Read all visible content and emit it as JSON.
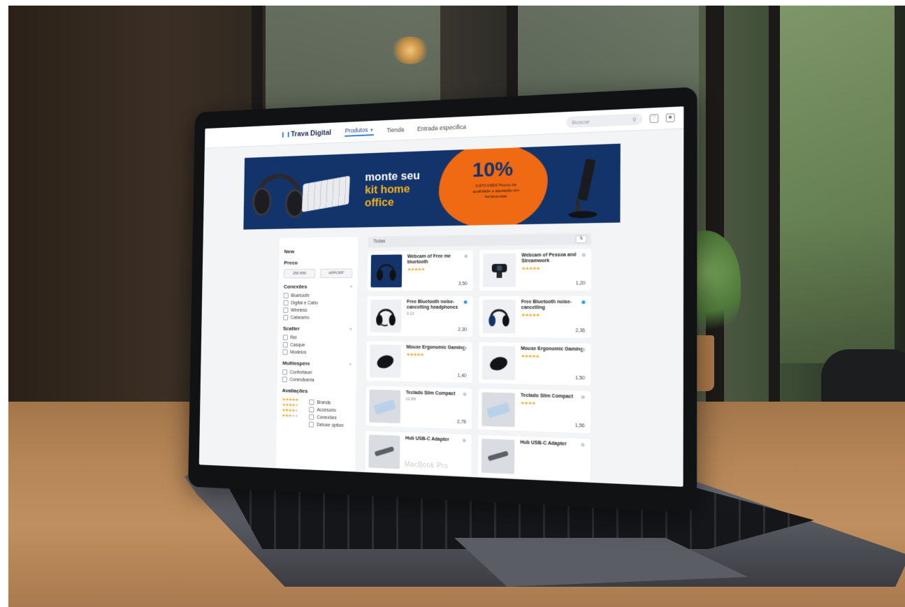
{
  "site": {
    "logo": "Trava Digital",
    "nav": [
      {
        "label": "Produtos",
        "active": true
      },
      {
        "label": "Tienda",
        "active": false
      },
      {
        "label": "Entrada especifica",
        "active": false
      }
    ],
    "search_placeholder": "Buscar"
  },
  "banner": {
    "line1": "monte seu",
    "line2": "kit home",
    "line3": "office",
    "discount": "10%",
    "discount_sub": "0,870 ASES Promo de qualidade e aquisição em ferramentas",
    "colors": {
      "background": "#13346b",
      "accent": "#ef6a13",
      "highlight": "#f5b21a"
    }
  },
  "sidebar": {
    "title": "New",
    "price": {
      "heading": "Preco",
      "min": "250 800",
      "max": "APPORT"
    },
    "groups": [
      {
        "heading": "Conexões",
        "options": [
          "Bluetooth",
          "Digital e Cabo",
          "Wireless",
          "Cabeamo"
        ]
      },
      {
        "heading": "Scatter",
        "options": [
          "Rei",
          "Casque",
          "Modelos"
        ]
      },
      {
        "heading": "Multiespére",
        "options": [
          "Confortável",
          "Conexãoeria"
        ]
      }
    ],
    "rating": {
      "heading": "Avaliações",
      "levels": [
        5,
        4,
        4,
        3,
        2
      ],
      "side_options": [
        "Brands",
        "Accesorio",
        "Conexões",
        "Deluxe option"
      ]
    }
  },
  "grid": {
    "header": "Todas",
    "products": [
      {
        "title": "Webcam of Free me bluetooth",
        "stars": 5,
        "sub": "",
        "price": "3,50",
        "thumb": "headphones",
        "tone": "navy",
        "fav": "gray"
      },
      {
        "title": "Webcam of Pessoa and Streamwork",
        "stars": 5,
        "sub": "",
        "price": "1,20",
        "thumb": "webcam",
        "tone": "light",
        "fav": "gray"
      },
      {
        "title": "Free Bluetooth noise-cancelling headphones",
        "stars": 0,
        "sub": "0.12",
        "price": "2,30",
        "thumb": "headphones-mic",
        "tone": "light",
        "fav": "blue"
      },
      {
        "title": "Free Bluetooth noise-cancelling",
        "stars": 5,
        "sub": "",
        "price": "2,36",
        "thumb": "headphones-blue",
        "tone": "light",
        "fav": "blue"
      },
      {
        "title": "Mouse Ergonomic Gaming",
        "stars": 5,
        "sub": "",
        "price": "1,40",
        "thumb": "mouse",
        "tone": "light",
        "fav": "gray"
      },
      {
        "title": "Mouse Ergonomic Gaming",
        "stars": 5,
        "sub": "",
        "price": "1,50",
        "thumb": "mouse",
        "tone": "light",
        "fav": "gray"
      },
      {
        "title": "Teclado Slim Compact",
        "stars": 0,
        "sub": "12.88",
        "price": "2,78",
        "thumb": "keyboard",
        "tone": "gray",
        "fav": "gray"
      },
      {
        "title": "Teclado Slim Compact",
        "stars": 4,
        "sub": "",
        "price": "1,56",
        "thumb": "keyboard",
        "tone": "gray",
        "fav": "gray"
      },
      {
        "title": "Hub USB-C Adapter",
        "stars": 0,
        "sub": "",
        "price": "",
        "thumb": "hub",
        "tone": "gray",
        "fav": "gray"
      },
      {
        "title": "Hub USB-C Adapter",
        "stars": 0,
        "sub": "",
        "price": "",
        "thumb": "hub",
        "tone": "gray",
        "fav": "gray"
      }
    ]
  },
  "device_label": "MacBook Pro"
}
